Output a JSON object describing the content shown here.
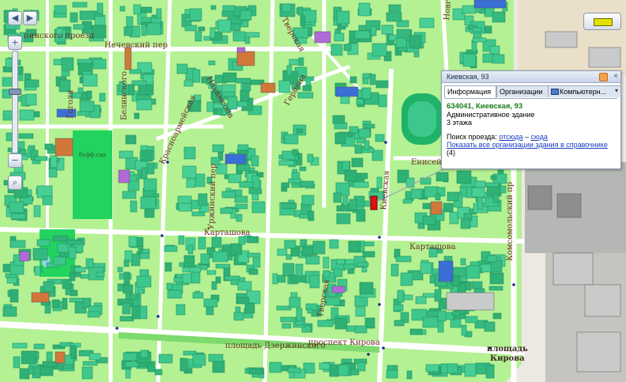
{
  "map": {
    "streets": [
      {
        "id": "st-1",
        "label": "пинского проезд"
      },
      {
        "id": "st-2",
        "label": "Нечевский пер"
      },
      {
        "id": "st-3",
        "label": "Гоголя"
      },
      {
        "id": "st-4",
        "label": "Белинского"
      },
      {
        "id": "st-5",
        "label": "Красноармейская"
      },
      {
        "id": "st-6",
        "label": "Уржинский пер"
      },
      {
        "id": "st-7",
        "label": "Карташова"
      },
      {
        "id": "st-8",
        "label": "Тверская"
      },
      {
        "id": "st-9",
        "label": "Герцена"
      },
      {
        "id": "st-10",
        "label": "Киевская"
      },
      {
        "id": "st-11",
        "label": "Енисейская"
      },
      {
        "id": "st-12",
        "label": "Карташова"
      },
      {
        "id": "st-13",
        "label": "Комсомольский пр"
      },
      {
        "id": "st-14",
        "label": "Тверская"
      },
      {
        "id": "st-15",
        "label": "проспект Кирова"
      },
      {
        "id": "st-16",
        "label": "площадь Дзержинского"
      },
      {
        "id": "st-17",
        "label": "площадь"
      },
      {
        "id": "st-18",
        "label": "Кирова"
      },
      {
        "id": "st-19",
        "label": "Новгородская"
      },
      {
        "id": "st-20",
        "label": "Нахимсона"
      }
    ],
    "poi_labels": [
      {
        "id": "poi-1",
        "label": "буфф.сад"
      }
    ]
  },
  "popup": {
    "title": "Киевская, 93",
    "tabs": [
      "Информация",
      "Организации",
      "Компьютерн..."
    ],
    "active_tab": "Информация",
    "address": "634041, Киевская, 93",
    "building_type": "Административное здание",
    "floors": "3 этажа",
    "route_prefix": "Поиск проезда:",
    "route_from": "отсюда",
    "route_dash": "–",
    "route_to": "сюда",
    "show_all_link": "Показать все организации здания в справочнике",
    "org_count": "(4)"
  },
  "colors": {
    "block_green": "#a6ef85",
    "building_teal": "#3ec78c",
    "road": "#ffffff",
    "highlight": "#e01010"
  }
}
